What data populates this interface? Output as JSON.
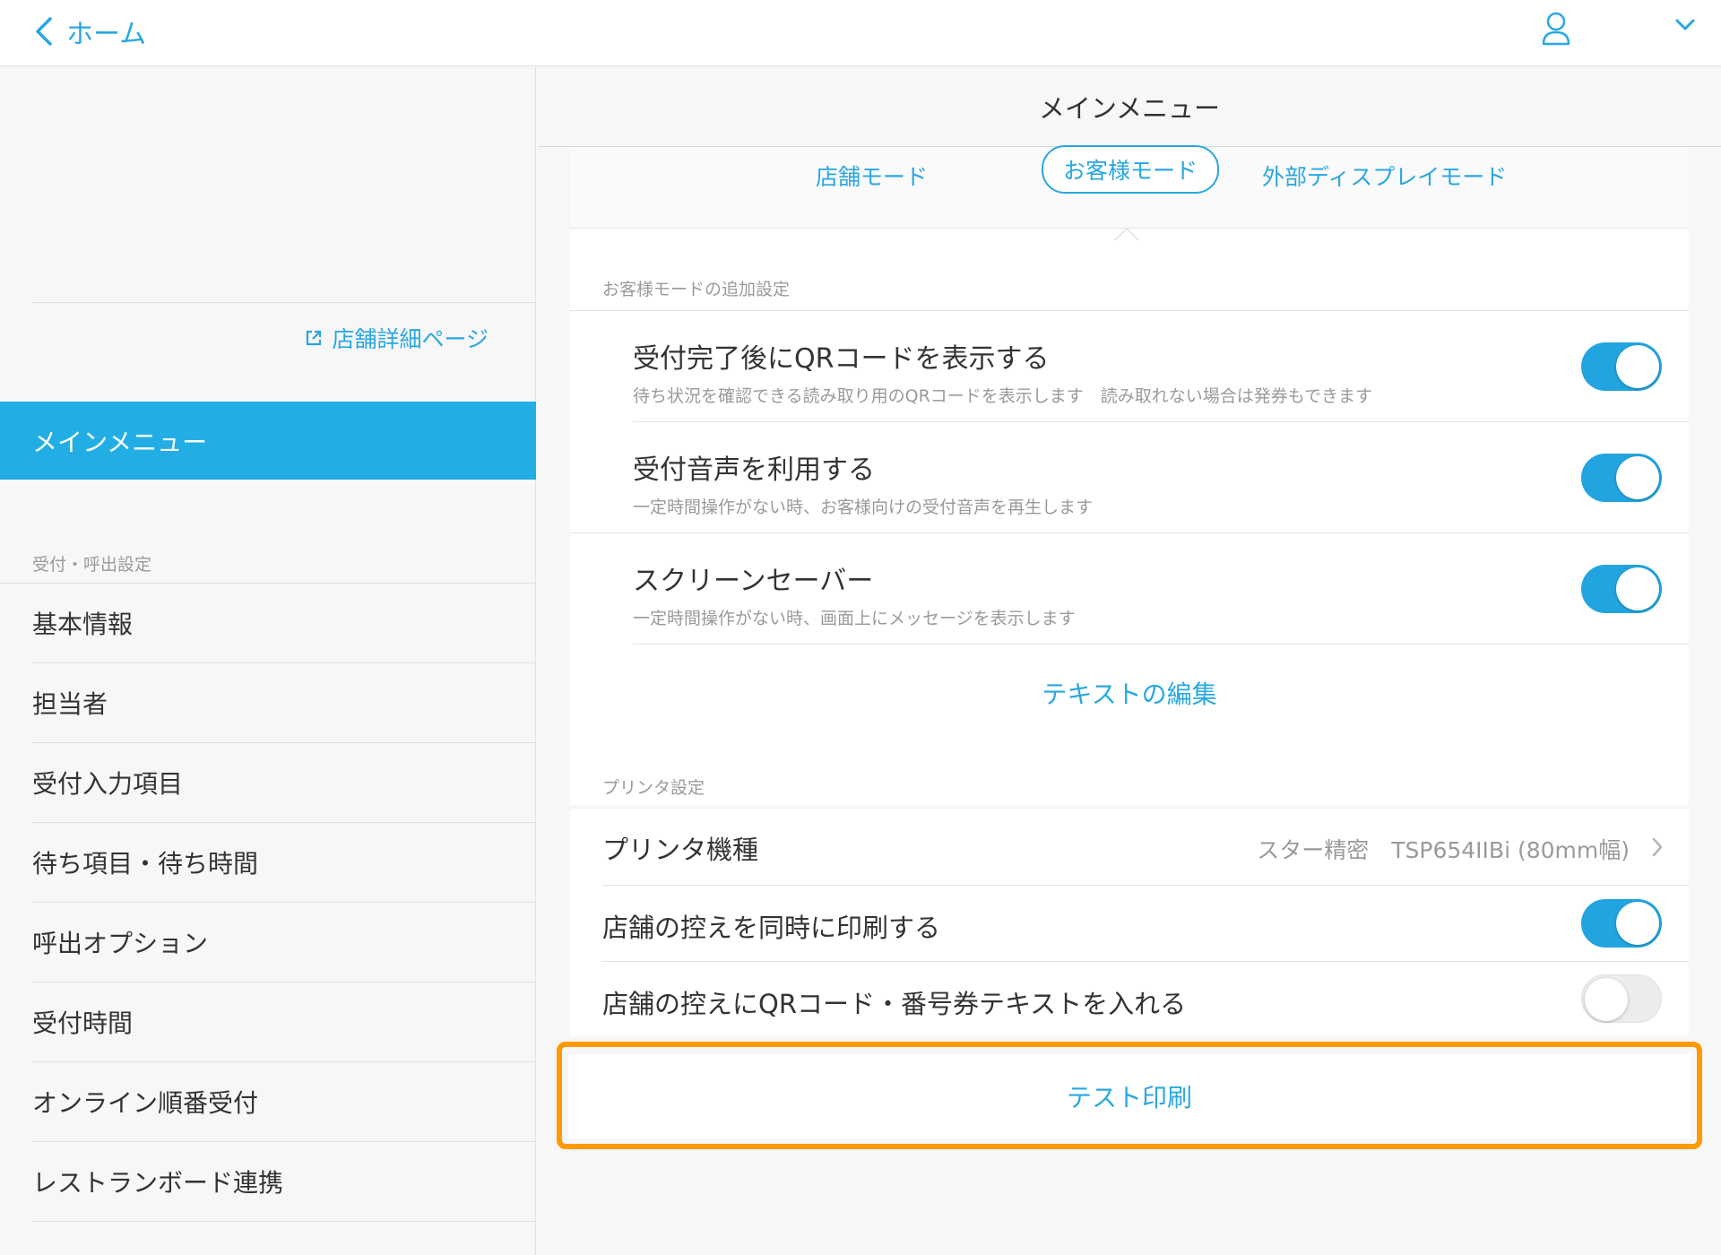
{
  "topbar": {
    "back_label": "ホーム"
  },
  "sidebar": {
    "store_link": "店舗詳細ページ",
    "active_item": "メインメニュー",
    "section_label": "受付・呼出設定",
    "items": [
      {
        "label": "基本情報"
      },
      {
        "label": "担当者"
      },
      {
        "label": "受付入力項目"
      },
      {
        "label": "待ち項目・待ち時間"
      },
      {
        "label": "呼出オプション"
      },
      {
        "label": "受付時間"
      },
      {
        "label": "オンライン順番受付"
      },
      {
        "label": "レストランボード連携"
      }
    ]
  },
  "main": {
    "title": "メインメニュー",
    "tabs": [
      {
        "label": "店舗モード",
        "active": false
      },
      {
        "label": "お客様モード",
        "active": true
      },
      {
        "label": "外部ディスプレイモード",
        "active": false
      }
    ],
    "customer_section": {
      "label": "お客様モードの追加設定",
      "rows": [
        {
          "title": "受付完了後にQRコードを表示する",
          "subtitle": "待ち状況を確認できる読み取り用のQRコードを表示します　読み取れない場合は発券もできます",
          "enabled": true
        },
        {
          "title": "受付音声を利用する",
          "subtitle": "一定時間操作がない時、お客様向けの受付音声を再生します",
          "enabled": true
        },
        {
          "title": "スクリーンセーバー",
          "subtitle": "一定時間操作がない時、画面上にメッセージを表示します",
          "enabled": true
        }
      ],
      "edit_text_link": "テキストの編集"
    },
    "printer_section": {
      "label": "プリンタ設定",
      "model_label": "プリンタ機種",
      "model_value": "スター精密　TSP654IIBi (80mm幅)",
      "print_copy_label": "店舗の控えを同時に印刷する",
      "print_copy_enabled": true,
      "include_qr_label": "店舗の控えにQRコード・番号券テキストを入れる",
      "include_qr_enabled": false,
      "test_print_label": "テスト印刷"
    }
  },
  "colors": {
    "accent": "#29a7e1",
    "active_sidebar": "#22aee4",
    "highlight": "#ff9a00"
  }
}
